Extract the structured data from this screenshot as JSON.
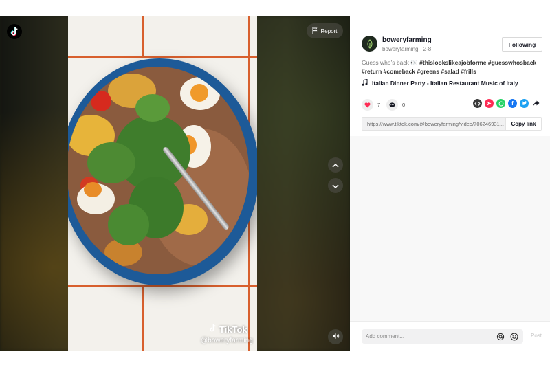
{
  "video": {
    "report_label": "Report",
    "watermark_brand": "TikTok",
    "watermark_handle": "@boweryfarming"
  },
  "author": {
    "username": "boweryfarming",
    "subline": "boweryfarming · 2-8",
    "follow_label": "Following"
  },
  "caption": {
    "text": "Guess who’s back 👀",
    "tags": [
      "#thislookslikeajobforme",
      "#guesswhosback",
      "#return",
      "#comeback",
      "#greens",
      "#salad",
      "#frills"
    ]
  },
  "music": {
    "title": "Italian Dinner Party - Italian Restaurant Music of Italy"
  },
  "stats": {
    "likes": "7",
    "comments": "0"
  },
  "share": {
    "link": "https://www.tiktok.com/@boweryfarming/video/706246931...",
    "copy_label": "Copy link",
    "icons": [
      "embed-icon",
      "send-to-friends-icon",
      "whatsapp-icon",
      "facebook-icon",
      "twitter-icon",
      "share-arrow-icon"
    ]
  },
  "comment_box": {
    "placeholder": "Add comment...",
    "post_label": "Post"
  },
  "colors": {
    "accent_pink": "#fe2c55",
    "whatsapp": "#25d366",
    "facebook": "#1877f2",
    "twitter": "#1da1f2"
  }
}
